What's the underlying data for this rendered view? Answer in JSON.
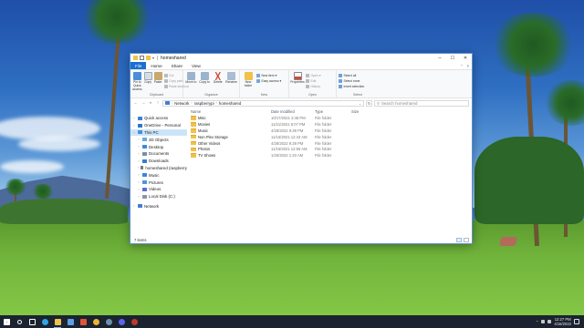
{
  "window": {
    "title": "homeshared",
    "controls": {
      "minimize": "─",
      "maximize": "☐",
      "close": "✕"
    }
  },
  "ribbon": {
    "tabs": [
      "File",
      "Home",
      "Share",
      "View"
    ],
    "groups": {
      "clipboard": {
        "label": "Clipboard",
        "pin": "Pin to Quick access",
        "copy": "Copy",
        "paste": "Paste",
        "cut": "Cut",
        "copy_path": "Copy path",
        "paste_shortcut": "Paste shortcut"
      },
      "organize": {
        "label": "Organize",
        "move_to": "Move to",
        "copy_to": "Copy to",
        "delete": "Delete",
        "rename": "Rename"
      },
      "new": {
        "label": "New",
        "new_folder": "New folder",
        "new_item": "New item ▾",
        "easy_access": "Easy access ▾"
      },
      "open": {
        "label": "Open",
        "properties": "Properties",
        "open": "Open ▾",
        "edit": "Edit",
        "history": "History"
      },
      "select": {
        "label": "Select",
        "select_all": "Select all",
        "select_none": "Select none",
        "invert": "Invert selection"
      }
    }
  },
  "addressbar": {
    "back": "←",
    "forward": "→",
    "up": "↑",
    "crumbs": [
      "Network",
      "raspberrypi",
      "homeshared"
    ],
    "refresh": "↻",
    "search_placeholder": "Search homeshared"
  },
  "navpane": [
    {
      "label": "Quick access",
      "indent": 0,
      "caret": "›",
      "color": "#3d7fd6"
    },
    {
      "label": "OneDrive - Personal",
      "indent": 0,
      "caret": "›",
      "color": "#2f74c9"
    },
    {
      "label": "This PC",
      "indent": 0,
      "caret": "⌄",
      "color": "#4a90d9",
      "selected": true
    },
    {
      "label": "3D Objects",
      "indent": 1,
      "caret": "›",
      "color": "#6aa9e0"
    },
    {
      "label": "Desktop",
      "indent": 1,
      "caret": "›",
      "color": "#3b8ad9"
    },
    {
      "label": "Documents",
      "indent": 1,
      "caret": "›",
      "color": "#7a8ea6"
    },
    {
      "label": "Downloads",
      "indent": 1,
      "caret": "›",
      "color": "#2f7fd0"
    },
    {
      "label": "homeshared (raspberry",
      "indent": 1,
      "caret": "›",
      "color": "#6d7a88"
    },
    {
      "label": "Music",
      "indent": 1,
      "caret": "›",
      "color": "#3d84d6"
    },
    {
      "label": "Pictures",
      "indent": 1,
      "caret": "›",
      "color": "#4d96d8"
    },
    {
      "label": "Videos",
      "indent": 1,
      "caret": "›",
      "color": "#5a6fd0"
    },
    {
      "label": "Local Disk (C:)",
      "indent": 1,
      "caret": "›",
      "color": "#8a96a6"
    },
    {
      "label": "Network",
      "indent": 0,
      "caret": "›",
      "color": "#3f7fcf"
    }
  ],
  "columns": {
    "name": "Name",
    "date": "Date modified",
    "type": "Type",
    "size": "Size"
  },
  "files": [
    {
      "name": "Misc",
      "date": "10/17/2021 3:48 PM",
      "type": "File folder"
    },
    {
      "name": "Movies",
      "date": "11/21/2021 6:07 PM",
      "type": "File folder"
    },
    {
      "name": "Music",
      "date": "4/28/2022 9:39 PM",
      "type": "File folder"
    },
    {
      "name": "Non Plex Storage",
      "date": "11/16/2021 12:43 AM",
      "type": "File folder"
    },
    {
      "name": "Other Videos",
      "date": "4/28/2022 9:39 PM",
      "type": "File folder"
    },
    {
      "name": "Photos",
      "date": "11/16/2021 12:59 AM",
      "type": "File folder"
    },
    {
      "name": "TV Shows",
      "date": "1/25/2022 1:20 AM",
      "type": "File folder"
    }
  ],
  "status": {
    "count": "7 items"
  },
  "taskbar": {
    "icons": [
      {
        "name": "start-icon",
        "color": "#ffffff"
      },
      {
        "name": "search-icon",
        "color": "#ffffff"
      },
      {
        "name": "task-view-icon",
        "color": "#ffffff"
      },
      {
        "name": "edge-icon",
        "color": "#2fa4e8"
      },
      {
        "name": "file-explorer-icon",
        "color": "#f0c14b",
        "active": true
      },
      {
        "name": "mail-icon",
        "color": "#5aa0e6"
      },
      {
        "name": "office-icon",
        "color": "#e0533a"
      },
      {
        "name": "chrome-icon",
        "color": "#e8b630"
      },
      {
        "name": "steam-icon",
        "color": "#6c8fb0"
      },
      {
        "name": "discord-icon",
        "color": "#5865f2"
      },
      {
        "name": "app-icon",
        "color": "#c0392b"
      }
    ],
    "time": "12:27 PM",
    "date": "4/16/2022"
  },
  "colors": {
    "accent": "#1a6fd1",
    "folder": "#f0c14b",
    "selection": "#cce4f7"
  }
}
